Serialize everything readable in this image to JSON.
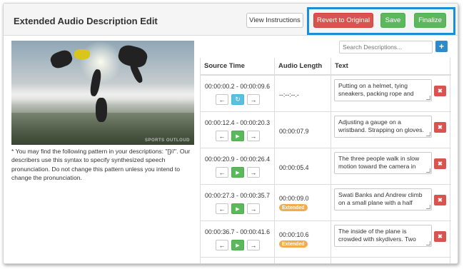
{
  "header": {
    "title": "Extended Audio Description Edit",
    "view_instructions_label": "View Instructions",
    "revert_label": "Revert to Original",
    "save_label": "Save",
    "finalize_label": "Finalize"
  },
  "video": {
    "watermark": "SPORTS OUTLOUD"
  },
  "note": "* You may find the following pattern in your descriptions: \"[]//\". Our describers use this syntax to specify synthesized speech pronunciation. Do not change this pattern unless you intend to change the pronunciation.",
  "search": {
    "placeholder": "Search Descriptions..."
  },
  "table": {
    "columns": [
      "Source Time",
      "Audio Length",
      "Text"
    ],
    "rows": [
      {
        "time": "00:00:00.2 - 00:00:09.6",
        "length": "--:--:--.-",
        "extended": false,
        "mode": "sync",
        "text": "Putting on a helmet, tying sneakers, packing rope and"
      },
      {
        "time": "00:00:12.4 - 00:00:20.3",
        "length": "00:00:07.9",
        "extended": false,
        "mode": "play",
        "text": "Adjusting a gauge on a wristband. Strapping on gloves."
      },
      {
        "time": "00:00:20.9 - 00:00:26.4",
        "length": "00:00:05.4",
        "extended": false,
        "mode": "play",
        "text": "The three people walk in slow motion toward the camera in"
      },
      {
        "time": "00:00:27.3 - 00:00:35.7",
        "length": "00:00:09.0",
        "extended": true,
        "mode": "play",
        "text": "Swati Banks and Andrew climb on a small plane with a half"
      },
      {
        "time": "00:00:36.7 - 00:00:41.6",
        "length": "00:00:10.6",
        "extended": true,
        "mode": "play",
        "text": "The inside of the plane is crowded with skydivers. Two"
      }
    ],
    "badge_label": "Extended",
    "icons": {
      "prev": "arrow-left-icon",
      "play": "play-icon",
      "sync": "refresh-icon",
      "next": "arrow-right-icon",
      "delete": "close-icon",
      "add": "plus-icon"
    }
  },
  "colors": {
    "revert": "#d9534f",
    "save": "#5cb85c",
    "finalize": "#5cb85c",
    "highlight": "#1a8fd6",
    "badge": "#f0ad4e",
    "add": "#2f8ac9"
  }
}
